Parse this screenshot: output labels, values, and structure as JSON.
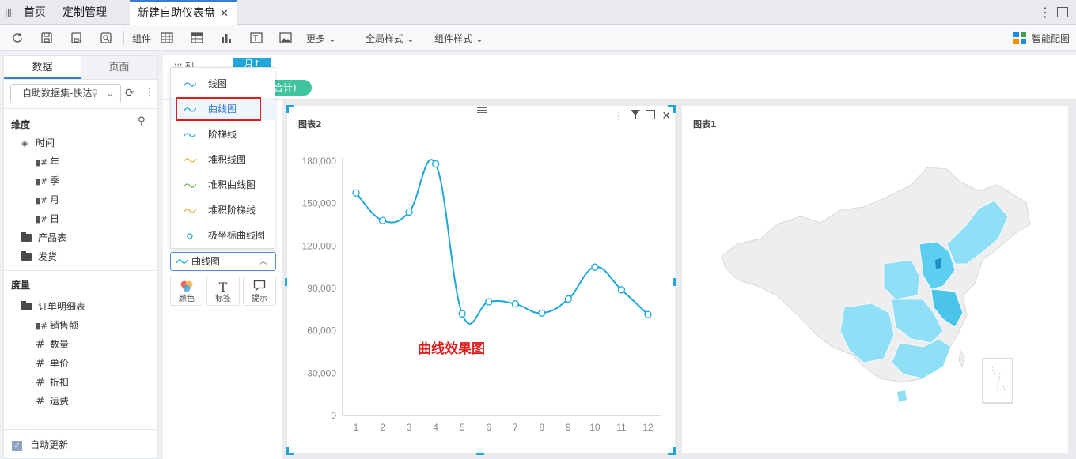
{
  "tabs": {
    "home": "首页",
    "custom": "定制管理",
    "active": "新建自助仪表盘",
    "close_glyph": "✕"
  },
  "toolbar": {
    "component": "组件",
    "more": "更多",
    "global_style": "全局样式",
    "component_style": "组件样式",
    "smart": "智能配图"
  },
  "left": {
    "tab_data": "数据",
    "tab_page": "页面",
    "dataset": "自助数据集-快达",
    "dimension": "维度",
    "time": "时间",
    "year": "年",
    "quarter": "季",
    "month": "月",
    "day": "日",
    "product": "产品表",
    "shipping": "发货",
    "measure": "度量",
    "order_detail": "订单明细表",
    "sales": "销售额",
    "qty": "数量",
    "price": "单价",
    "discount": "折扣",
    "freight": "运费",
    "auto_update": "自动更新"
  },
  "shelf": {
    "col_label": "列",
    "month_pill": "月↑",
    "sum_pill": "合计)"
  },
  "dropdown": {
    "items": [
      "线图",
      "曲线图",
      "阶梯线",
      "堆积线图",
      "堆积曲线图",
      "堆积阶梯线",
      "极坐标曲线图"
    ],
    "selected_index": 1
  },
  "config": {
    "chart_type": "曲线图",
    "color": "颜色",
    "label": "标签",
    "tooltip": "提示",
    "label_glyph": "T"
  },
  "colors": {
    "accent": "#1ea7d8",
    "line": "#1ea7d8",
    "annotation": "#e01e1e",
    "pill_green": "#3fc4a0"
  },
  "chart_data": {
    "type": "line",
    "title": "图表2",
    "x": [
      "1",
      "2",
      "3",
      "4",
      "5",
      "6",
      "7",
      "8",
      "9",
      "10",
      "11",
      "12"
    ],
    "values": [
      157500,
      138000,
      144000,
      178000,
      72000,
      80500,
      79000,
      72500,
      82500,
      105000,
      89000,
      71500
    ],
    "ylim": [
      0,
      180000
    ],
    "yticks": [
      "0",
      "30,000",
      "60,000",
      "90,000",
      "120,000",
      "150,000",
      "180,000"
    ],
    "smooth": true,
    "grid": false
  },
  "map_card": {
    "title": "图表1"
  },
  "annotation": "曲线效果图"
}
